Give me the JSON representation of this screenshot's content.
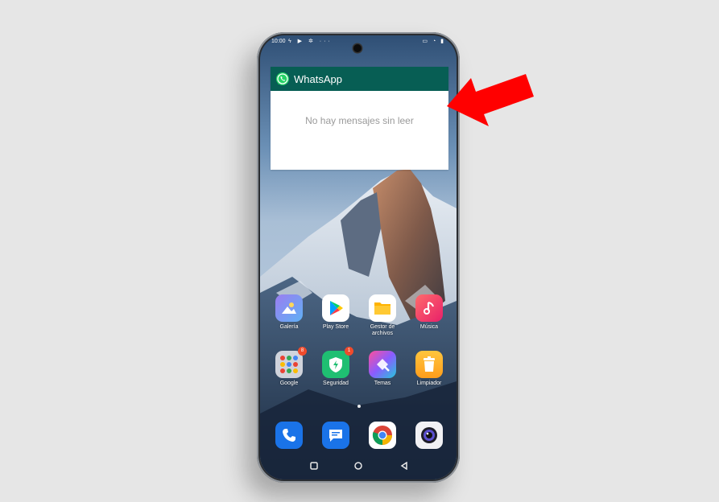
{
  "status_bar": {
    "time": "10:00",
    "left_icons": "ϟ ▶ ✲ ···",
    "right_icons": "▭ ◔ ▮"
  },
  "widget": {
    "title": "WhatsApp",
    "message": "No hay mensajes sin leer",
    "header_color": "#075e54",
    "logo_icon": "whatsapp-icon"
  },
  "annotation_color": "#ff0000",
  "apps": [
    {
      "label": "Galería",
      "icon": "gallery-icon"
    },
    {
      "label": "Play Store",
      "icon": "play-store-icon"
    },
    {
      "label": "Gestor de archivos",
      "icon": "file-manager-icon"
    },
    {
      "label": "Música",
      "icon": "music-icon"
    },
    {
      "label": "Google",
      "icon": "google-folder-icon",
      "badge": "8"
    },
    {
      "label": "Seguridad",
      "icon": "security-icon",
      "badge": "1"
    },
    {
      "label": "Temas",
      "icon": "themes-icon"
    },
    {
      "label": "Limpiador",
      "icon": "cleaner-icon"
    }
  ],
  "dock": [
    {
      "icon": "phone-icon"
    },
    {
      "icon": "messages-icon"
    },
    {
      "icon": "chrome-icon"
    },
    {
      "icon": "camera-icon"
    }
  ],
  "nav_bar": {
    "recents": "recents-icon",
    "home": "home-icon",
    "back": "back-icon"
  }
}
